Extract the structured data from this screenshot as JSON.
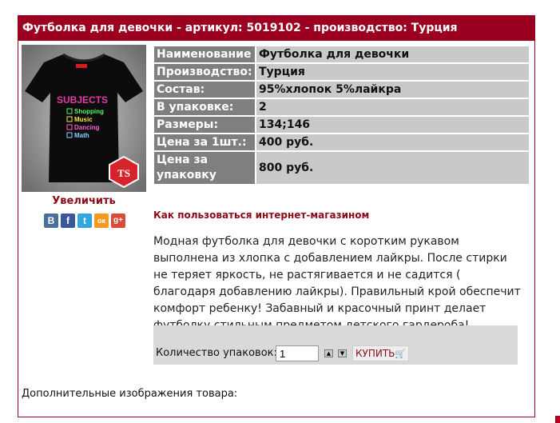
{
  "header": {
    "title": "Футболка для девочки - артикул: 5019102 - производство: Турция"
  },
  "product": {
    "image_alt": "Футболка для девочки",
    "enlarge_label": "Увеличить",
    "print_title": "SUBJECTS",
    "print_items": [
      "Shopping",
      "Music",
      "Dancing",
      "Math"
    ],
    "logo_text": "TS"
  },
  "share": [
    {
      "icon": "vk-icon",
      "glyph": "В",
      "color": "#4a6f9b"
    },
    {
      "icon": "facebook-icon",
      "glyph": "f",
      "color": "#3b5998"
    },
    {
      "icon": "twitter-icon",
      "glyph": "t",
      "color": "#2fa8e0"
    },
    {
      "icon": "odnoklassniki-icon",
      "glyph": "ок",
      "color": "#f59a1f"
    },
    {
      "icon": "googleplus-icon",
      "glyph": "g+",
      "color": "#d94a38"
    }
  ],
  "properties": [
    {
      "key": "Наименование",
      "value": "Футболка для девочки"
    },
    {
      "key": "Производство:",
      "value": "Турция"
    },
    {
      "key": "Состав:",
      "value": "95%хлопок 5%лайкра"
    },
    {
      "key": "В упаковке:",
      "value": "2"
    },
    {
      "key": "Размеры:",
      "value": "134;146"
    },
    {
      "key": "Цена за 1шт.:",
      "value": "400 руб."
    },
    {
      "key": "Цена за упаковку",
      "value": "800 руб."
    }
  ],
  "links": {
    "how_to_use": "Как пользоваться интернет-магазином"
  },
  "description": "Модная футболка для девочки с коротким рукавом выполнена из хлопка с добавлением лайкры. После стирки не теряет яркость, не растягивается и не садится ( благодаря добавлению лайкры). Правильный крой обеспечит комфорт ребенку! Забавный и красочный принт делает футболку стильным предметом  детского гардероба!",
  "order": {
    "quantity_label": "Количество упаковок:",
    "quantity_value": "1",
    "buy_label": "КУПИТЬ"
  },
  "footer": {
    "additional_images": "Дополнительные изображения товара:"
  },
  "colors": {
    "brand": "#9b0021",
    "key_cell": "#7f7f7f",
    "value_cell": "#c9c9c9"
  }
}
